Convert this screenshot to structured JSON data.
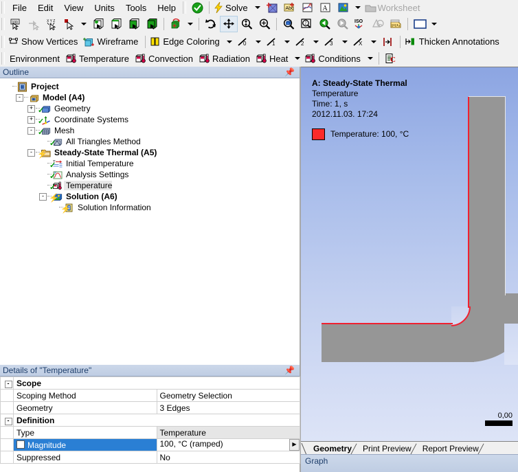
{
  "menu": {
    "items": [
      "File",
      "Edit",
      "View",
      "Units",
      "Tools",
      "Help"
    ],
    "check_icon": "green-check-icon",
    "solve_label": "Solve",
    "solve_icon": "lightning-icon",
    "new_chart_icon": "new-chart-icon",
    "comment_icon": "comment-icon",
    "chart_icon": "chart-icon",
    "annotation_icon": "text-annotation-icon",
    "image_icon": "image-icon",
    "worksheet_label": "Worksheet",
    "worksheet_icon": "worksheet-icon"
  },
  "toolbar_graphics": {
    "icons": [
      "select-mode-icon",
      "extend-selection-icon",
      "xyz-probe-icon",
      "cursor-mode-icon",
      "vertex-select-icon",
      "edge-select-icon",
      "face-select-icon",
      "body-select-icon",
      "rotate-cube-icon",
      "undo-view-icon",
      "pan-icon",
      "zoom-icon",
      "box-zoom-icon",
      "fit-icon",
      "magnify-icon",
      "previous-view-icon",
      "next-view-icon",
      "iso-view-icon",
      "section-plane-icon",
      "ruler-icon",
      "viewport-layout-icon"
    ]
  },
  "toolbar_display": {
    "show_vertices": "Show Vertices",
    "wireframe": "Wireframe",
    "edge_coloring": "Edge Coloring",
    "thicken_annotations": "Thicken Annotations",
    "edge_thickness_labels": [
      "0",
      "1",
      "2",
      "3",
      "X"
    ]
  },
  "toolbar_environment": {
    "environment_label": "Environment",
    "items": [
      "Temperature",
      "Convection",
      "Radiation",
      "Heat",
      "Conditions"
    ],
    "worksheet_icon": "worksheet-env-icon"
  },
  "outline": {
    "title": "Outline",
    "pin_icon": "pin-icon",
    "nodes": [
      {
        "label": "Project",
        "indent": 0,
        "expander": "",
        "icon": "project-icon",
        "bold": true,
        "status": "",
        "selected": false
      },
      {
        "label": "Model (A4)",
        "indent": 1,
        "expander": "-",
        "icon": "model-icon",
        "bold": true,
        "status": "",
        "selected": false
      },
      {
        "label": "Geometry",
        "indent": 2,
        "expander": "+",
        "icon": "geometry-icon",
        "bold": false,
        "status": "check",
        "selected": false
      },
      {
        "label": "Coordinate Systems",
        "indent": 2,
        "expander": "+",
        "icon": "coordsys-icon",
        "bold": false,
        "status": "check",
        "selected": false
      },
      {
        "label": "Mesh",
        "indent": 2,
        "expander": "-",
        "icon": "mesh-icon",
        "bold": false,
        "status": "check",
        "selected": false
      },
      {
        "label": "All Triangles Method",
        "indent": 3,
        "expander": "",
        "icon": "method-icon",
        "bold": false,
        "status": "check",
        "selected": false
      },
      {
        "label": "Steady-State Thermal (A5)",
        "indent": 2,
        "expander": "-",
        "icon": "folder-icon",
        "bold": true,
        "status": "bolt",
        "selected": false
      },
      {
        "label": "Initial Temperature",
        "indent": 3,
        "expander": "",
        "icon": "initial-temp-icon",
        "bold": false,
        "status": "check",
        "selected": false
      },
      {
        "label": "Analysis Settings",
        "indent": 3,
        "expander": "",
        "icon": "settings-icon",
        "bold": false,
        "status": "check",
        "selected": false
      },
      {
        "label": "Temperature",
        "indent": 3,
        "expander": "",
        "icon": "temperature-icon",
        "bold": false,
        "status": "check",
        "selected": true
      },
      {
        "label": "Solution (A6)",
        "indent": 3,
        "expander": "-",
        "icon": "solution-icon",
        "bold": true,
        "status": "bolt",
        "selected": false
      },
      {
        "label": "Solution Information",
        "indent": 4,
        "expander": "",
        "icon": "info-icon",
        "bold": false,
        "status": "bolt",
        "selected": false
      }
    ]
  },
  "details": {
    "title": "Details of \"Temperature\"",
    "pin_icon": "pin-icon",
    "rows": [
      {
        "kind": "group",
        "key": "Scope",
        "value": "",
        "expander": "-"
      },
      {
        "kind": "row",
        "key": "Scoping Method",
        "value": "Geometry Selection",
        "readonly": false
      },
      {
        "kind": "row",
        "key": "Geometry",
        "value": "3 Edges",
        "readonly": false
      },
      {
        "kind": "group",
        "key": "Definition",
        "value": "",
        "expander": "-"
      },
      {
        "kind": "row",
        "key": "Type",
        "value": "Temperature",
        "readonly": true
      },
      {
        "kind": "selrow",
        "key": "Magnitude",
        "value": "100, °C  (ramped)",
        "checkbox": true,
        "hasbutton": true
      },
      {
        "kind": "row",
        "key": "Suppressed",
        "value": "No",
        "readonly": false
      }
    ]
  },
  "viewport": {
    "legend": {
      "line1": "A: Steady-State Thermal",
      "line2": "Temperature",
      "line3": "Time: 1, s",
      "line4": "2012.11.03. 17:24",
      "swatch_label": "Temperature: 100, °C",
      "swatch_color": "#fc2a2a"
    },
    "scale_value": "0,00",
    "geometry_color": "#969696",
    "selected_edge_color": "#f02030"
  },
  "bottom_tabs": {
    "tabs": [
      "Geometry",
      "Print Preview",
      "Report Preview"
    ],
    "active": "Geometry"
  },
  "graph_panel": {
    "title": "Graph"
  }
}
